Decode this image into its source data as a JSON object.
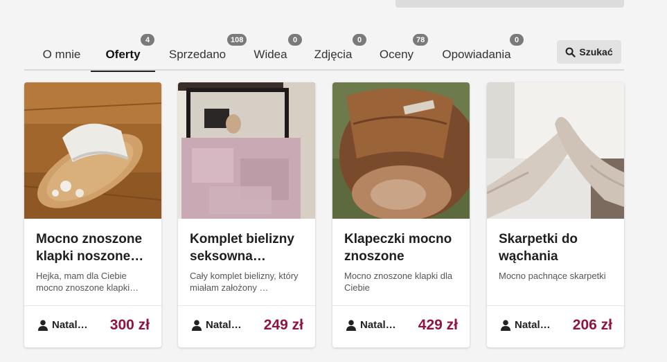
{
  "tabs": [
    {
      "label": "O mnie",
      "badge": ""
    },
    {
      "label": "Oferty",
      "badge": "4"
    },
    {
      "label": "Sprzedano",
      "badge": "108"
    },
    {
      "label": "Widea",
      "badge": "0"
    },
    {
      "label": "Zdjęcia",
      "badge": "0"
    },
    {
      "label": "Oceny",
      "badge": "78"
    },
    {
      "label": "Opowiadania",
      "badge": "0"
    }
  ],
  "active_tab": "Oferty",
  "search": {
    "label": "Szukać",
    "icon": "search-icon"
  },
  "cards": [
    {
      "title": "Mocno znoszone klapki noszone…",
      "desc": "Hejka, mam dla Ciebie mocno znoszone klapki…",
      "user": "Natal…",
      "price": "300 zł",
      "image": "worn-white-sandal-photo"
    },
    {
      "title": "Komplet bielizny seksowna…",
      "desc": "Cały komplet bielizny, który miałam założony …",
      "user": "Natal…",
      "price": "249 zł",
      "image": "blurred-mirror-selfie-photo"
    },
    {
      "title": "Klapeczki mocno znoszone",
      "desc": "Mocno znoszone klapki dla Ciebie",
      "user": "Natal…",
      "price": "429 zł",
      "image": "brown-leather-sandal-photo"
    },
    {
      "title": "Skarpetki do wąchania",
      "desc": "Mocno pachnące skarpetki",
      "user": "Natal…",
      "price": "206 zł",
      "image": "beige-socks-feet-photo"
    }
  ],
  "colors": {
    "price": "#8e1444",
    "badge": "#7a7a7a",
    "tab_active_underline": "#222222",
    "page_bg": "#f4f4f4"
  }
}
